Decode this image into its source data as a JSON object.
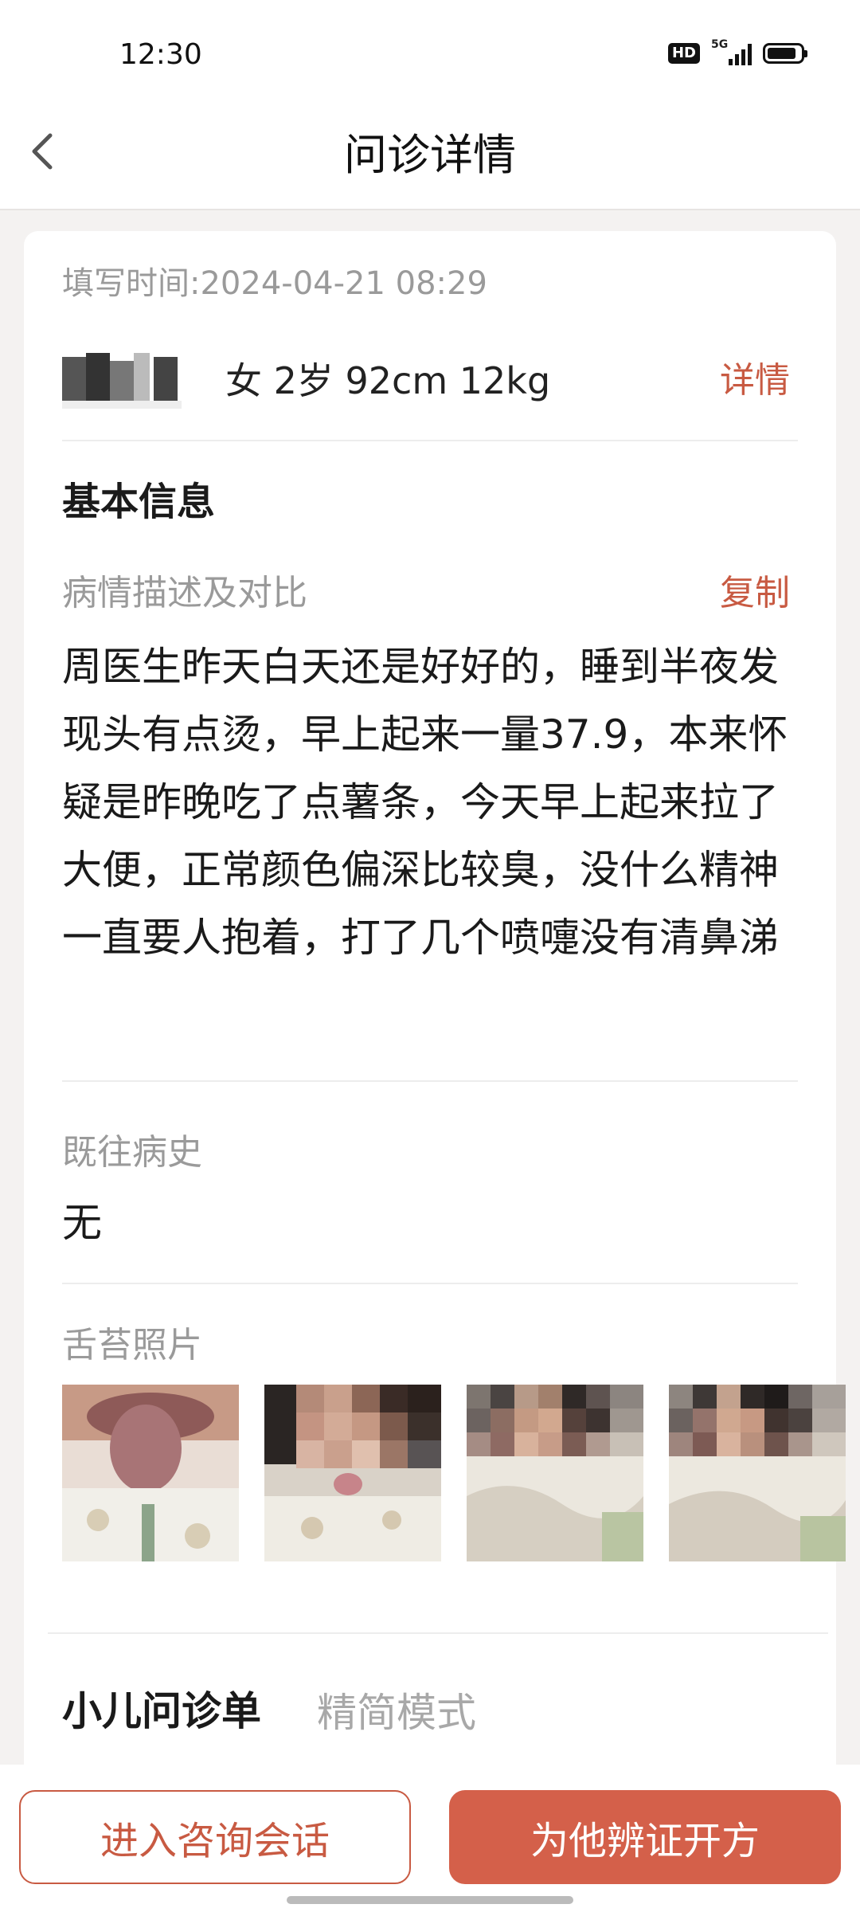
{
  "status_bar": {
    "time": "12:30",
    "hd": "HD",
    "network": "5G"
  },
  "header": {
    "title": "问诊详情"
  },
  "card": {
    "fill_time_label": "填写时间:",
    "fill_time_value": "2024-04-21 08:29",
    "patient": {
      "info": "女 2岁 92cm 12kg",
      "detail_label": "详情"
    },
    "basic_info_title": "基本信息",
    "condition": {
      "label": "病情描述及对比",
      "copy_label": "复制",
      "text": "周医生昨天白天还是好好的，睡到半夜发现头有点烫，早上起来一量37.9，本来怀疑是昨晚吃了点薯条，今天早上起来拉了大便，正常颜色偏深比较臭，没什么精神一直要人抱着，打了几个喷嚏没有清鼻涕"
    },
    "history": {
      "label": "既往病史",
      "value": "无"
    },
    "tongue_photos": {
      "label": "舌苔照片",
      "count": 4
    },
    "form": {
      "title": "小儿问诊单",
      "mode": "精简模式"
    }
  },
  "actions": {
    "enter_chat": "进入咨询会话",
    "prescribe": "为他辨证开方"
  },
  "colors": {
    "accent": "#c85a42",
    "primary_button": "#d4604a",
    "muted_text": "#9a9a9a",
    "background": "#f4f2f1"
  }
}
